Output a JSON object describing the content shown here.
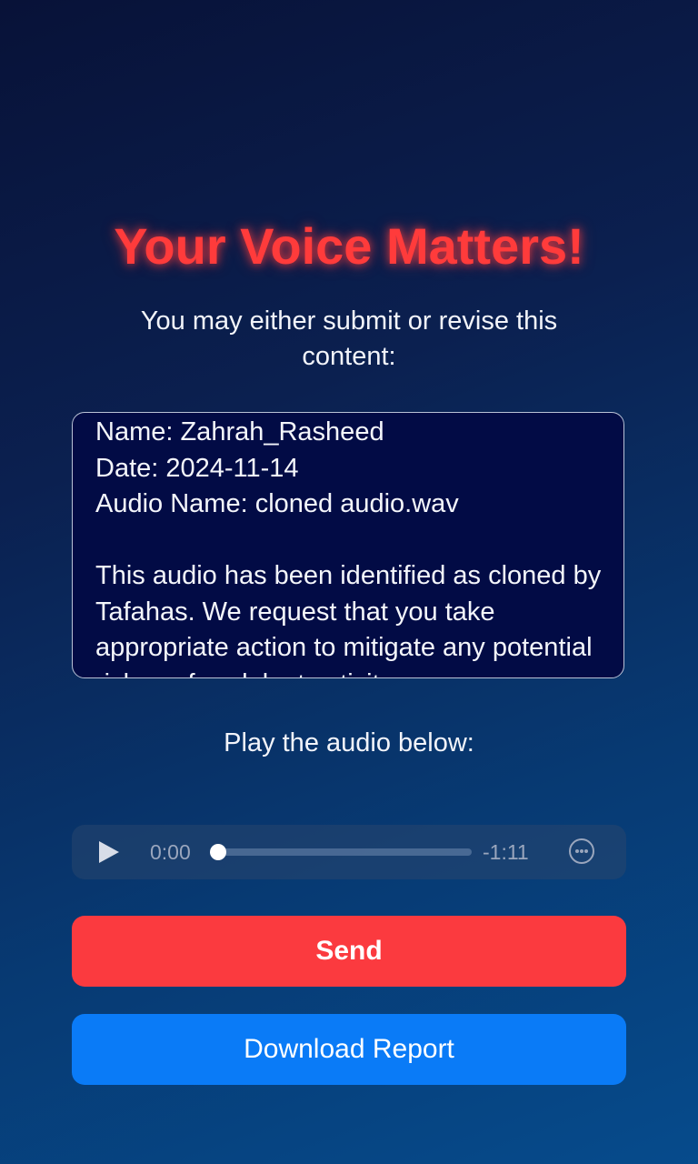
{
  "header": {
    "title": "Your Voice Matters!",
    "subtitle": "You may either submit or revise this content:"
  },
  "report": {
    "text": "Name: Zahrah_Rasheed\nDate: 2024-11-14\nAudio Name: cloned audio.wav\n\nThis audio has been identified as cloned by Tafahas. We request that you take appropriate action to mitigate any potential risks or fraudulent activity."
  },
  "audio": {
    "caption": "Play the audio below:",
    "current_time": "0:00",
    "remaining_time": "-1:11",
    "progress_fraction": 0.0
  },
  "actions": {
    "send_label": "Send",
    "download_label": "Download Report"
  },
  "colors": {
    "title": "#ff3b3b",
    "send": "#fb3a3f",
    "download": "#0a7bf7",
    "textarea_bg": "#020b45"
  },
  "icons": {
    "play": "play-icon",
    "more": "more-options-icon"
  }
}
